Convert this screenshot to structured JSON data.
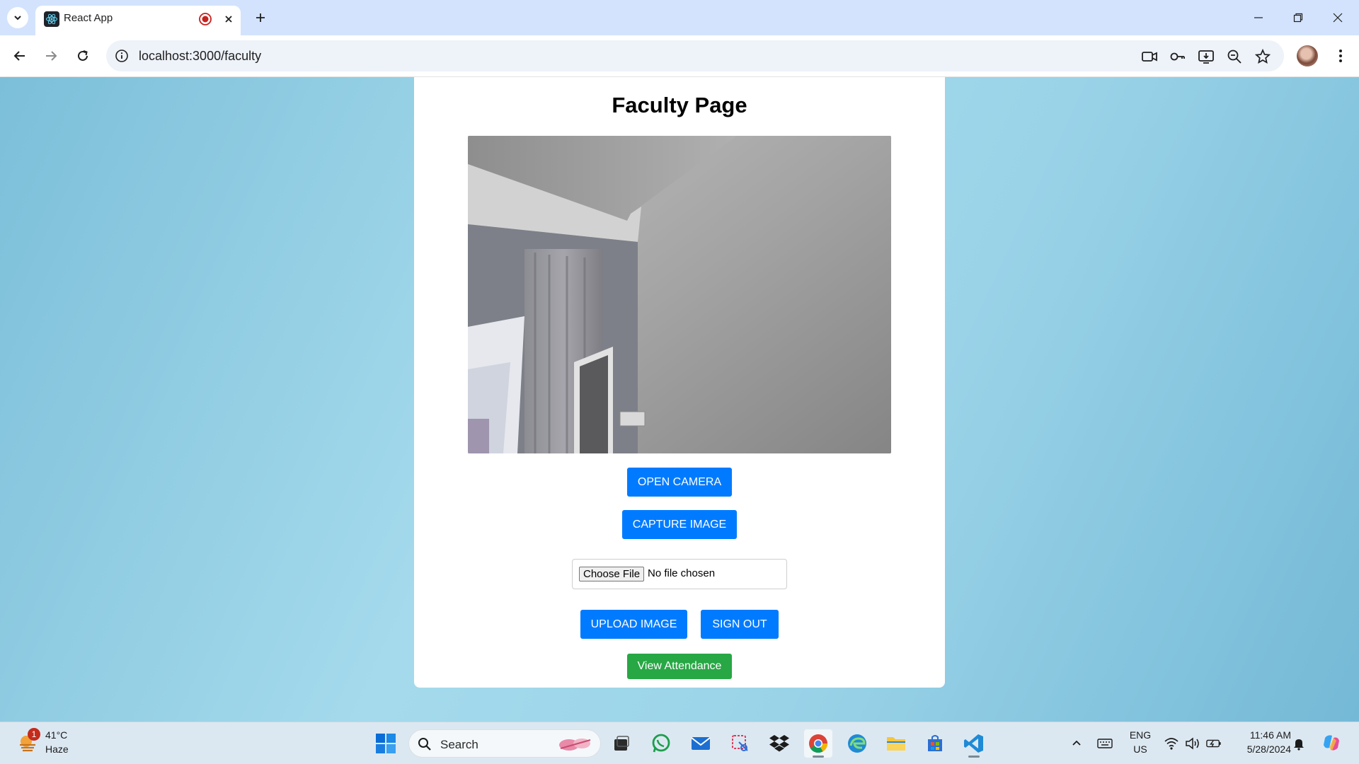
{
  "browser": {
    "tab_title": "React App",
    "url": "localhost:3000/faculty"
  },
  "page": {
    "title": "Faculty Page",
    "buttons": {
      "open_camera": "OPEN CAMERA",
      "capture_image": "CAPTURE IMAGE",
      "upload_image": "UPLOAD IMAGE",
      "sign_out": "SIGN OUT",
      "view_attendance": "View Attendance"
    },
    "file_input": {
      "button_label": "Choose File",
      "status": "No file chosen"
    }
  },
  "colors": {
    "primary_button": "#007bff",
    "success_button": "#28a745",
    "tabstrip": "#d3e3fd"
  },
  "taskbar": {
    "weather": {
      "temp": "41°C",
      "condition": "Haze",
      "badge": "1"
    },
    "search_placeholder": "Search",
    "apps": [
      "start-icon",
      "task-view-icon",
      "whatsapp-icon",
      "mail-icon",
      "snipping-tool-icon",
      "dropbox-icon",
      "chrome-icon",
      "edge-icon",
      "file-explorer-icon",
      "store-icon",
      "vscode-icon"
    ],
    "language": {
      "line1": "ENG",
      "line2": "US"
    },
    "clock": {
      "time": "11:46 AM",
      "date": "5/28/2024"
    }
  }
}
